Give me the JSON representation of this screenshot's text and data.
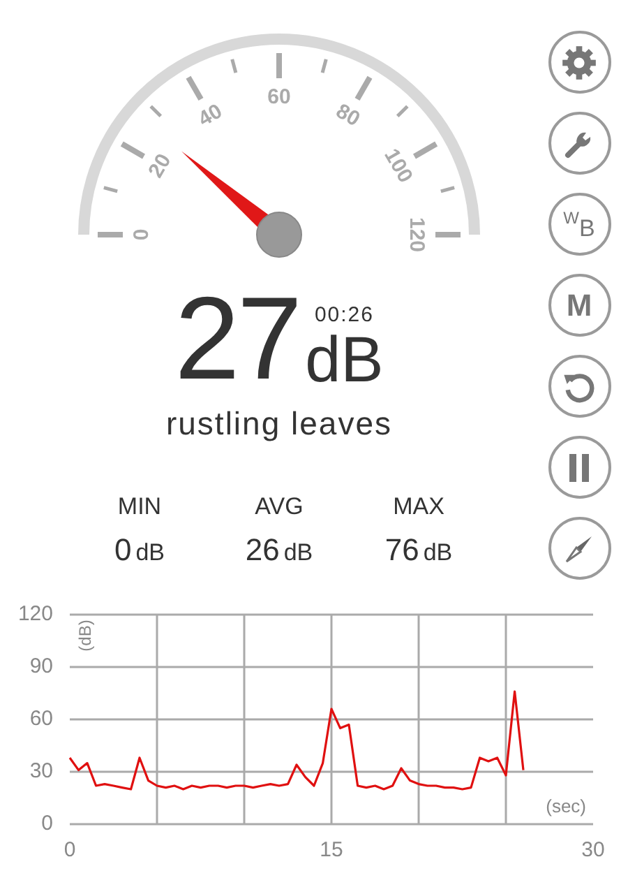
{
  "gauge": {
    "labels": [
      "0",
      "20",
      "40",
      "60",
      "80",
      "100",
      "120"
    ]
  },
  "reading": {
    "value": "27",
    "unit": "dB",
    "elapsed": "00:26",
    "description": "rustling leaves"
  },
  "stats": [
    {
      "label": "MIN",
      "value": "0",
      "unit": "dB"
    },
    {
      "label": "AVG",
      "value": "26",
      "unit": "dB"
    },
    {
      "label": "MAX",
      "value": "76",
      "unit": "dB"
    }
  ],
  "side_buttons": [
    {
      "kind": "gear"
    },
    {
      "kind": "wrench"
    },
    {
      "kind": "pair",
      "label": "W",
      "sub": "B"
    },
    {
      "kind": "text",
      "label": "M"
    },
    {
      "kind": "reset"
    },
    {
      "kind": "pause"
    },
    {
      "kind": "compass"
    }
  ],
  "history": {
    "chart_data": {
      "type": "line",
      "xlabel": "(sec)",
      "ylabel": "(dB)",
      "grid": true,
      "xlim": [
        0,
        30
      ],
      "ylim": [
        0,
        120
      ],
      "xticks": [
        0,
        15,
        30
      ],
      "yticks": [
        0,
        30,
        60,
        90,
        120
      ],
      "x": [
        0,
        0.5,
        1,
        1.5,
        2,
        2.5,
        3,
        3.5,
        4,
        4.5,
        5,
        5.5,
        6,
        6.5,
        7,
        7.5,
        8,
        8.5,
        9,
        9.5,
        10,
        10.5,
        11,
        11.5,
        12,
        12.5,
        13,
        13.5,
        14,
        14.5,
        15,
        15.5,
        16,
        16.5,
        17,
        17.5,
        18,
        18.5,
        19,
        19.5,
        20,
        20.5,
        21,
        21.5,
        22,
        22.5,
        23,
        23.5,
        24,
        24.5,
        25,
        25.5,
        26
      ],
      "series": [
        {
          "color": "#e01010",
          "values": [
            38,
            31,
            35,
            22,
            23,
            22,
            21,
            20,
            38,
            25,
            22,
            21,
            22,
            20,
            22,
            21,
            22,
            22,
            21,
            22,
            22,
            21,
            22,
            23,
            22,
            23,
            34,
            27,
            22,
            35,
            66,
            55,
            57,
            22,
            21,
            22,
            20,
            22,
            32,
            25,
            23,
            22,
            22,
            21,
            21,
            20,
            21,
            38,
            36,
            38,
            28,
            76,
            31
          ]
        }
      ]
    }
  }
}
